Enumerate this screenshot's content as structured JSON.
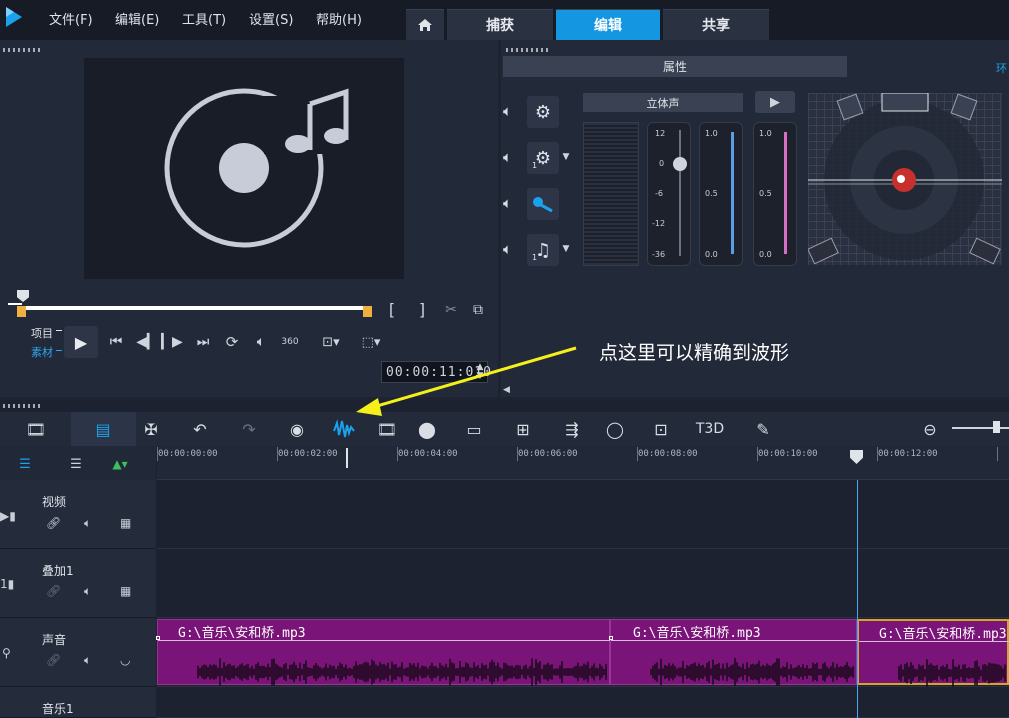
{
  "menu": {
    "file": "文件(F)",
    "edit": "编辑(E)",
    "tools": "工具(T)",
    "settings": "设置(S)",
    "help": "帮助(H)"
  },
  "tabs": {
    "home_icon": "home-icon",
    "capture": "捕获",
    "edit": "编辑",
    "share": "共享"
  },
  "player": {
    "project_label": "项目",
    "clip_label": "素材",
    "timecode": "00:00:11:010",
    "mark_in": "[",
    "mark_out": "]"
  },
  "audio_panel": {
    "properties_tab": "属性",
    "surround_tab": "环",
    "stereo_label": "立体声",
    "channel_counts": [
      "1",
      "1"
    ],
    "fader_scale": [
      "12",
      "0",
      "-6",
      "-12",
      "-36"
    ],
    "meter_scale": [
      "1.0",
      "0.5",
      "0.0"
    ]
  },
  "annotation": {
    "text": "点这里可以精确到波形",
    "arrow_color": "#f5f01a"
  },
  "ruler": {
    "ticks": [
      "00:00:00:00",
      "00:00:02:00",
      "00:00:04:00",
      "00:00:06:00",
      "00:00:08:00",
      "00:00:10:00",
      "00:00:12:00"
    ]
  },
  "tracks": {
    "video": "视频",
    "overlay": "叠加1",
    "voice": "声音",
    "music": "音乐1"
  },
  "clips": [
    "G:\\音乐\\安和桥.mp3",
    "G:\\音乐\\安和桥.mp3",
    "G:\\音乐\\安和桥.mp3"
  ],
  "colors": {
    "accent": "#1496e0",
    "clip": "#7b1478",
    "waveform": "#180818"
  }
}
